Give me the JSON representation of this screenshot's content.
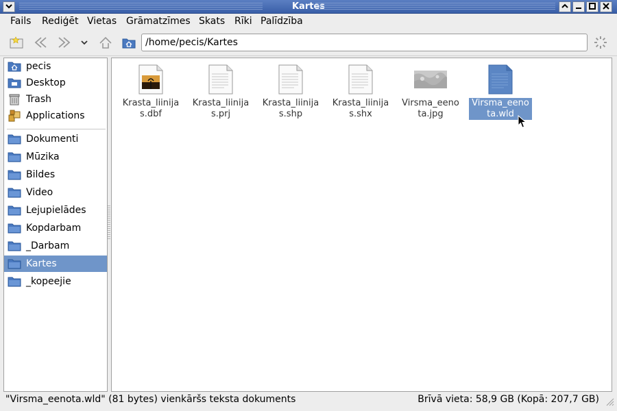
{
  "window": {
    "title": "Kartes"
  },
  "menu": [
    "Fails",
    "Rediģēt",
    "Vietas",
    "Grāmatzīmes",
    "Skats",
    "Rīki",
    "Palīdzība"
  ],
  "location": {
    "path": "/home/pecis/Kartes"
  },
  "sidebar": {
    "places": [
      {
        "label": "pecis",
        "icon": "home-folder-icon"
      },
      {
        "label": "Desktop",
        "icon": "desktop-icon"
      },
      {
        "label": "Trash",
        "icon": "trash-icon"
      },
      {
        "label": "Applications",
        "icon": "applications-icon"
      }
    ],
    "bookmarks": [
      {
        "label": "Dokumenti",
        "icon": "folder-icon"
      },
      {
        "label": "Mūzika",
        "icon": "folder-icon"
      },
      {
        "label": "Bildes",
        "icon": "folder-icon"
      },
      {
        "label": "Video",
        "icon": "folder-icon"
      },
      {
        "label": "Lejupielādes",
        "icon": "folder-icon"
      },
      {
        "label": "Kopdarbam",
        "icon": "folder-icon"
      },
      {
        "label": "_Darbam",
        "icon": "folder-icon"
      },
      {
        "label": "Kartes",
        "icon": "folder-icon",
        "selected": true
      },
      {
        "label": "_kopeejie",
        "icon": "folder-icon"
      }
    ]
  },
  "files": [
    {
      "name": "Krasta_liinijas.dbf",
      "icon": "dbf-file-icon"
    },
    {
      "name": "Krasta_liinijas.prj",
      "icon": "text-file-icon"
    },
    {
      "name": "Krasta_liinijas.shp",
      "icon": "text-file-icon"
    },
    {
      "name": "Krasta_liinijas.shx",
      "icon": "text-file-icon"
    },
    {
      "name": "Virsma_eenota.jpg",
      "icon": "image-thumbnail-icon"
    },
    {
      "name": "Virsma_eenota.wld",
      "icon": "text-file-icon",
      "selected": true
    }
  ],
  "status": {
    "left": "\"Virsma_eenota.wld\" (81 bytes) vienkāršs teksta dokuments",
    "right": "Brīvā vieta: 58,9 GB (Kopā: 207,7 GB)"
  },
  "colors": {
    "selection": "#6f95c9",
    "titlebar": "#3a5fa8",
    "folder": "#4a79c0"
  }
}
